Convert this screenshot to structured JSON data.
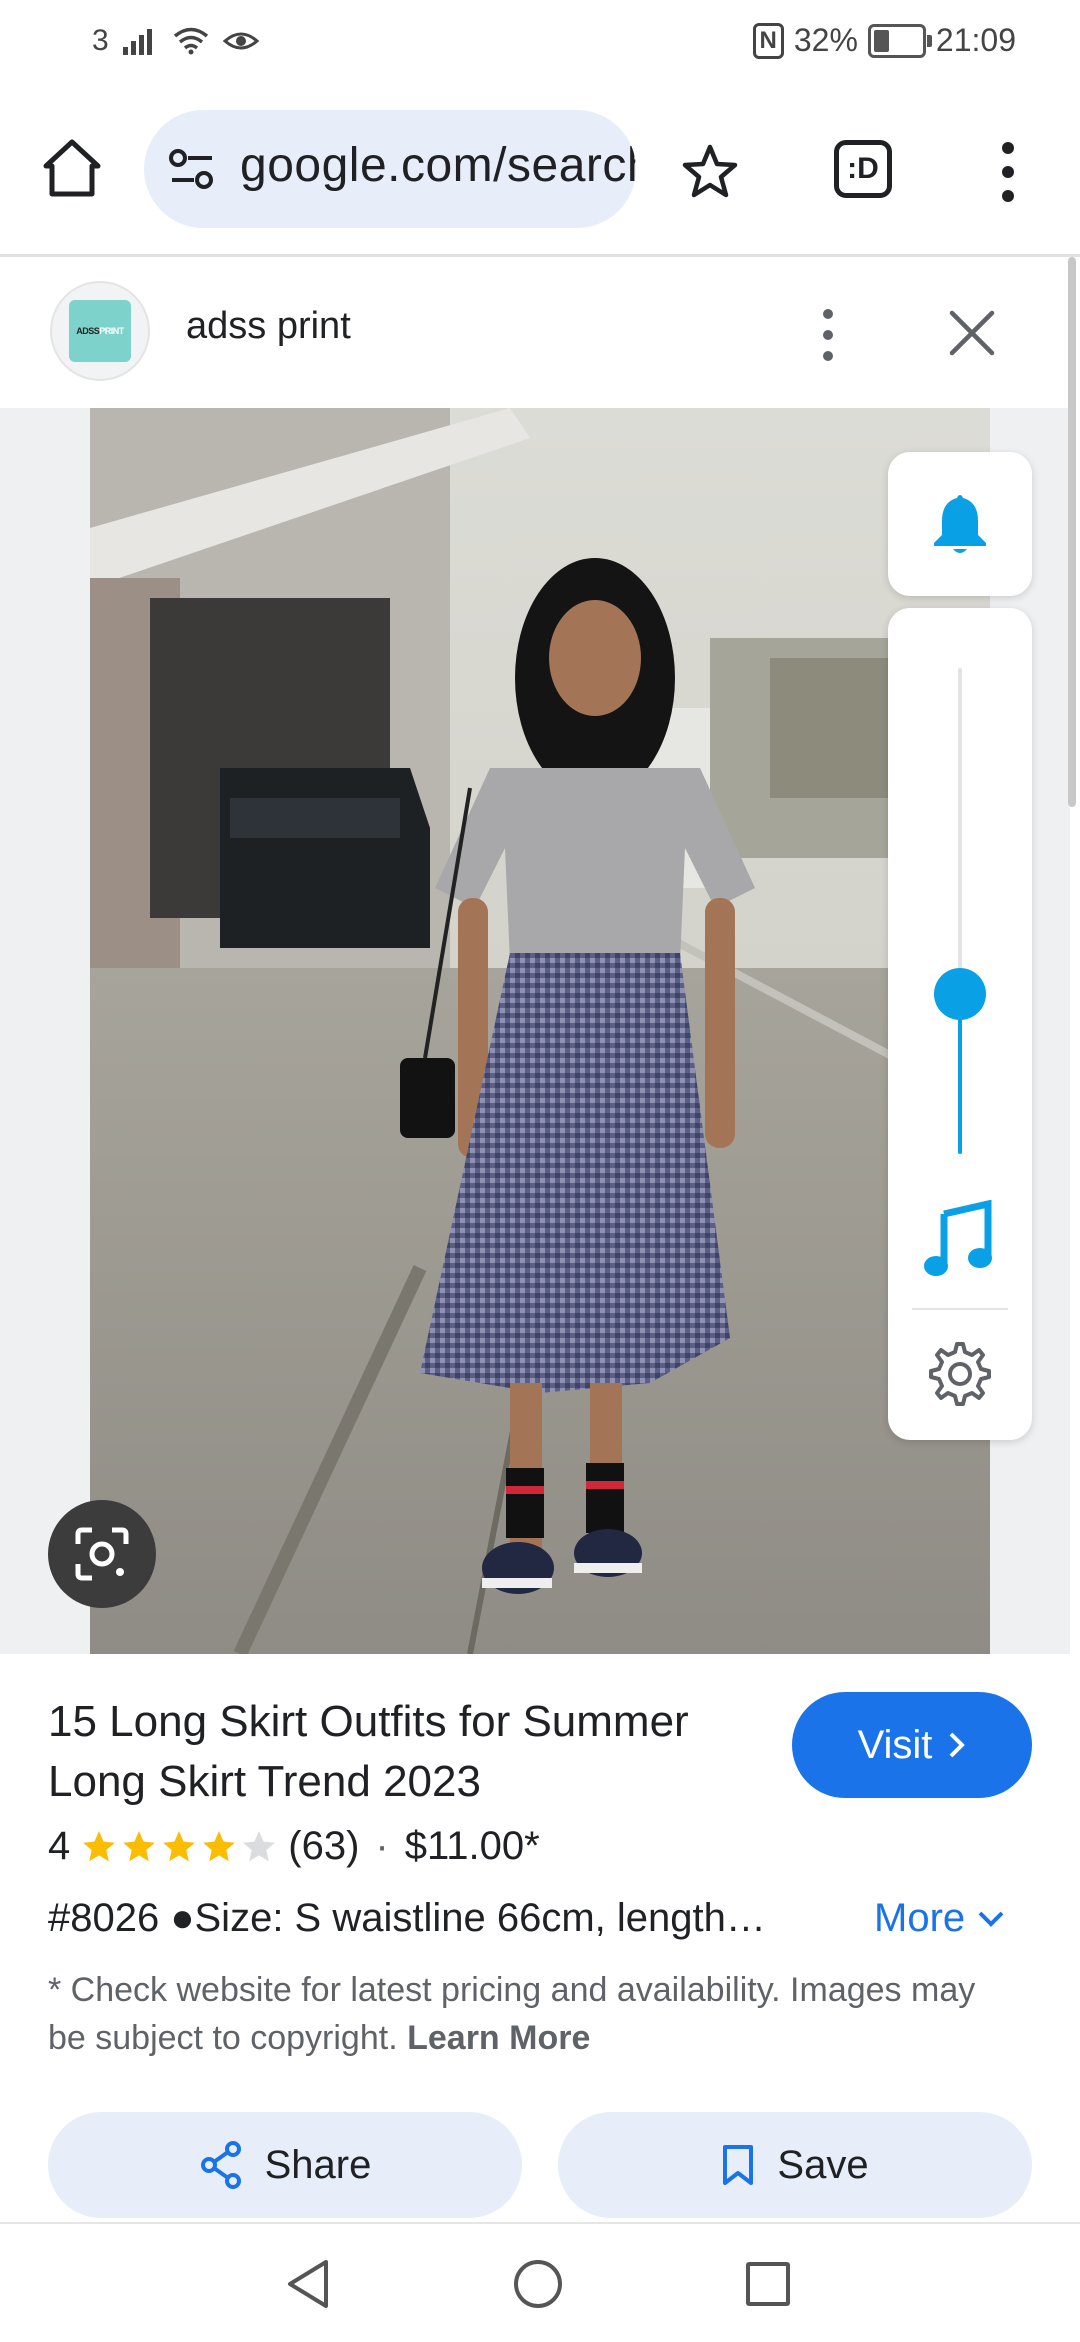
{
  "status_bar": {
    "sim_label": "3",
    "battery_percent": "32%",
    "battery_level": 0.32,
    "time": "21:09"
  },
  "browser": {
    "url_text": "google.com/search"
  },
  "source": {
    "name": "adss print",
    "logo_text_dark": "ADSS",
    "logo_text_light": "PRINT"
  },
  "volume_panel": {
    "level": 0.33,
    "accent_color": "#0aa0e6"
  },
  "product": {
    "title": "15 Long Skirt Outfits for Summer Long Skirt Trend 2023",
    "visit_label": "Visit",
    "rating_value": "4",
    "rating_stars": 4,
    "review_count": "(63)",
    "separator": "·",
    "price": "$11.00*",
    "description": "#8026 ●Size: S waistline 66cm, length…",
    "more_label": "More",
    "disclaimer": "* Check website for latest pricing and availability. Images may be subject to copyright.",
    "learn_more_label": "Learn More"
  },
  "actions": {
    "share_label": "Share",
    "save_label": "Save"
  },
  "colors": {
    "accent_blue": "#1a73e8",
    "star_gold": "#fbbc04",
    "pill_background": "#e8eef9"
  }
}
